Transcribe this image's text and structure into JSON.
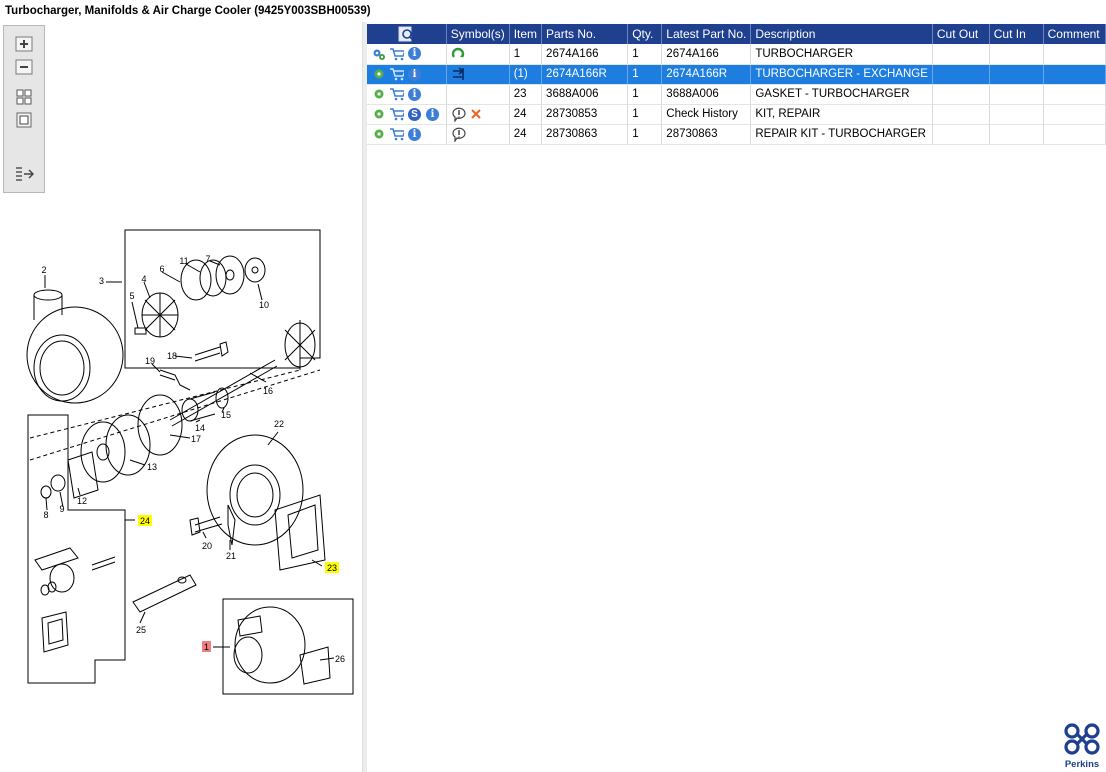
{
  "window": {
    "title": "Turbocharger, Manifolds & Air Charge Cooler (9425Y003SBH00539)"
  },
  "zoom_toolbar": {
    "tools": [
      {
        "name": "zoom-in-icon"
      },
      {
        "name": "zoom-out-icon"
      },
      {
        "name": "fit-page-icon"
      },
      {
        "name": "actual-size-icon"
      },
      {
        "name": "expand-panel-icon"
      }
    ]
  },
  "diagram": {
    "callouts": {
      "c1": "1",
      "c2": "2",
      "c3": "3",
      "c4": "4",
      "c5": "5",
      "c6": "6",
      "c7": "7",
      "c8": "8",
      "c9": "9",
      "c10": "10",
      "c11": "11",
      "c12": "12",
      "c13": "13",
      "c14": "14",
      "c15": "15",
      "c16": "16",
      "c17": "17",
      "c18": "18",
      "c19": "19",
      "c20": "20",
      "c21": "21",
      "c22": "22",
      "c23": "23",
      "c24": "24",
      "c25": "25",
      "c26": "26"
    },
    "highlight_color": "#ffff00",
    "selected_color": "#f08080"
  },
  "table": {
    "headers": {
      "find": "",
      "symbols": "Symbol(s)",
      "item": "Item",
      "parts_no": "Parts No.",
      "qty": "Qty.",
      "latest": "Latest Part No.",
      "description": "Description",
      "cut_out": "Cut Out",
      "cut_in": "Cut In",
      "comment": "Comment"
    },
    "rows": [
      {
        "item": "1",
        "parts_no": "2674A166",
        "qty": "1",
        "latest": "2674A166",
        "description": "TURBOCHARGER",
        "cut_out": "",
        "cut_in": "",
        "comment": ""
      },
      {
        "item": "(1)",
        "parts_no": "2674A166R",
        "qty": "1",
        "latest": "2674A166R",
        "description": "TURBOCHARGER - EXCHANGE",
        "cut_out": "",
        "cut_in": "",
        "comment": ""
      },
      {
        "item": "23",
        "parts_no": "3688A006",
        "qty": "1",
        "latest": "3688A006",
        "description": "GASKET - TURBOCHARGER",
        "cut_out": "",
        "cut_in": "",
        "comment": ""
      },
      {
        "item": "24",
        "parts_no": "28730853",
        "qty": "1",
        "latest": "Check History",
        "description": "KIT, REPAIR",
        "cut_out": "",
        "cut_in": "",
        "comment": ""
      },
      {
        "item": "24",
        "parts_no": "28730863",
        "qty": "1",
        "latest": "28730863",
        "description": "REPAIR KIT - TURBOCHARGER",
        "cut_out": "",
        "cut_in": "",
        "comment": ""
      }
    ],
    "row_icons": {
      "gear": "gear-icon",
      "cart": "cart-icon",
      "info": "info-icon",
      "s": "s-icon",
      "remanufactured": "reman-icon",
      "exchange": "exchange-icon",
      "notice": "notice-icon",
      "cross": "cross-icon"
    },
    "colors": {
      "header_bg": "#1f3f8f",
      "selected_bg": "#1e7ee0"
    }
  },
  "logo": {
    "text": "Perkins"
  }
}
